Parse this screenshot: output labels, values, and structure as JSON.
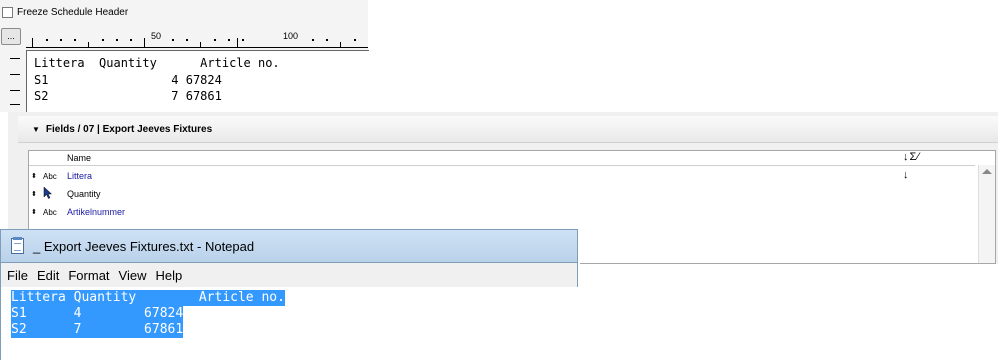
{
  "schedule": {
    "freeze_header_label": "Freeze Schedule Header",
    "ellipsis_label": "...",
    "ruler": {
      "label_50": "50",
      "label_100": "100"
    },
    "preview": {
      "header": "Littera  Quantity      Article no.",
      "rows": [
        "S1                 4 67824",
        "S2                 7 67861"
      ]
    }
  },
  "fields": {
    "header": "Fields / 07 | Export Jeeves Fixtures",
    "column_name": "Name",
    "column_icons": "↓Σ⁄",
    "row_arrow": "↓",
    "rows": [
      {
        "sort": "⬍",
        "type": "Abc",
        "name": "Littera",
        "color": "#1a1aa6"
      },
      {
        "sort": "⬍",
        "type": "",
        "name": "Quantity",
        "color": "#000000"
      },
      {
        "sort": "⬍",
        "type": "Abc",
        "name": "Artikelnummer",
        "color": "#1a1aa6"
      }
    ]
  },
  "notepad": {
    "title": "_ Export Jeeves Fixtures.txt - Notepad",
    "menu": [
      "File",
      "Edit",
      "Format",
      "View",
      "Help"
    ],
    "lines": [
      "Littera Quantity        Article no.",
      "S1      4        67824",
      "S2      7        67861"
    ],
    "selection_color": "#3399ff"
  }
}
